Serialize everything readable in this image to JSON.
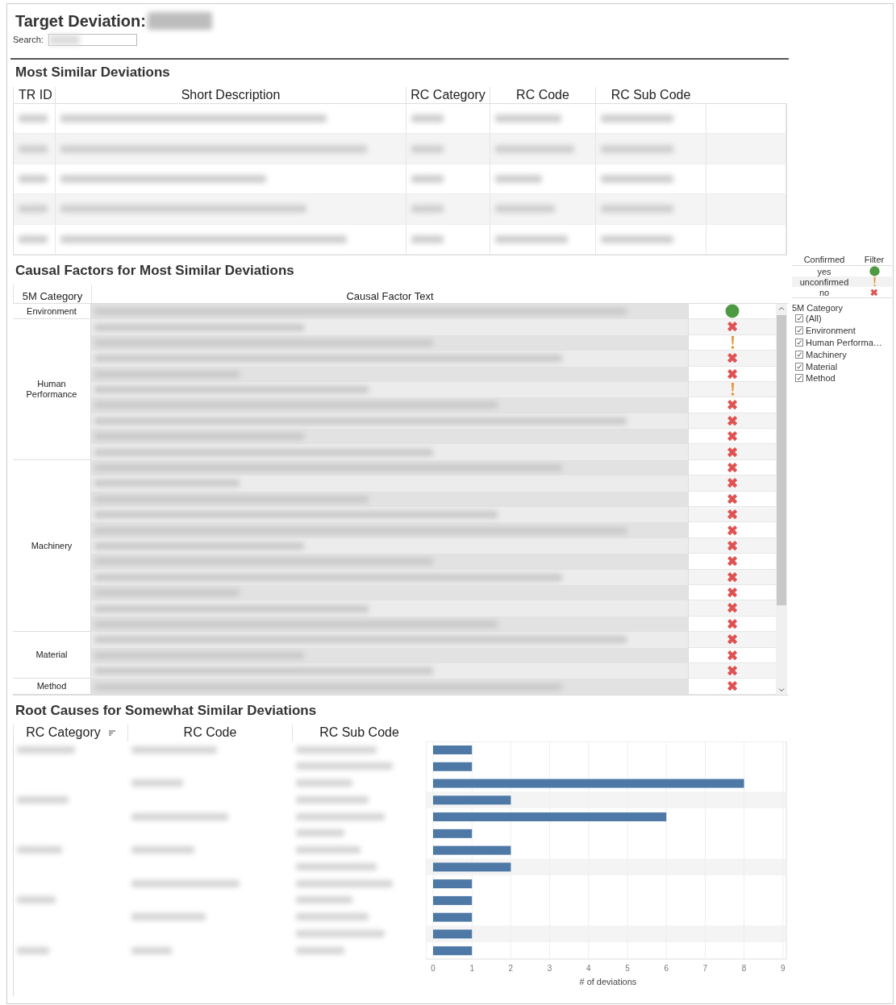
{
  "header": {
    "title": "Target Deviation:",
    "search_label": "Search:"
  },
  "similar": {
    "title": "Most Similar Deviations",
    "columns": [
      "TR ID",
      "Short Description",
      "RC Category",
      "RC Code",
      "RC Sub Code"
    ],
    "rows": [
      {
        "kind": "redacted"
      },
      {
        "kind": "redacted"
      },
      {
        "kind": "redacted"
      },
      {
        "kind": "redacted"
      },
      {
        "kind": "redacted"
      }
    ]
  },
  "causal": {
    "title": "Causal Factors for Most Similar Deviations",
    "columns": [
      "5M Category",
      "Causal Factor Text"
    ],
    "groups": [
      {
        "name": "Environment",
        "rows": [
          {
            "kind": "confirmed"
          }
        ]
      },
      {
        "name": "Human\nPerformance",
        "rows": [
          {
            "kind": "rejected"
          },
          {
            "kind": "unconfirmed"
          },
          {
            "kind": "rejected"
          },
          {
            "kind": "rejected"
          },
          {
            "kind": "unconfirmed"
          },
          {
            "kind": "rejected"
          },
          {
            "kind": "rejected"
          },
          {
            "kind": "rejected"
          },
          {
            "kind": "rejected"
          }
        ]
      },
      {
        "name": "Machinery",
        "rows": [
          {
            "kind": "rejected"
          },
          {
            "kind": "rejected"
          },
          {
            "kind": "rejected"
          },
          {
            "kind": "rejected"
          },
          {
            "kind": "rejected"
          },
          {
            "kind": "rejected"
          },
          {
            "kind": "rejected"
          },
          {
            "kind": "rejected"
          },
          {
            "kind": "rejected"
          },
          {
            "kind": "rejected"
          },
          {
            "kind": "rejected"
          }
        ]
      },
      {
        "name": "Material",
        "rows": [
          {
            "kind": "rejected"
          },
          {
            "kind": "rejected"
          },
          {
            "kind": "rejected"
          }
        ]
      },
      {
        "name": "Method",
        "rows": [
          {
            "kind": "rejected"
          }
        ]
      }
    ]
  },
  "legend": {
    "columns": [
      "Confirmed",
      "Filter"
    ],
    "items": [
      {
        "label": "yes",
        "kind": "confirmed"
      },
      {
        "label": "unconfirmed",
        "kind": "unconfirmed"
      },
      {
        "label": "no",
        "kind": "rejected"
      }
    ],
    "filter_title": "5M Category",
    "filters": [
      {
        "label": "(All)",
        "checked": true
      },
      {
        "label": "Environment",
        "checked": true
      },
      {
        "label": "Human Performa…",
        "checked": true
      },
      {
        "label": "Machinery",
        "checked": true
      },
      {
        "label": "Material",
        "checked": true
      },
      {
        "label": "Method",
        "checked": true
      }
    ]
  },
  "root_causes": {
    "title": "Root Causes for Somewhat Similar Deviations",
    "columns": [
      {
        "label": "RC Category",
        "sorted": true
      },
      {
        "label": "RC Code",
        "sorted": false
      },
      {
        "label": "RC Sub Code",
        "sorted": false
      }
    ],
    "chart_data": {
      "type": "bar",
      "orientation": "horizontal",
      "xlabel": "# of deviations",
      "values": [
        1,
        1,
        8,
        2,
        6,
        1,
        2,
        2,
        1,
        1,
        1,
        1,
        1
      ],
      "xlim": [
        0,
        9
      ],
      "xticks": [
        0,
        1,
        2,
        3,
        4,
        5,
        6,
        7,
        8,
        9
      ],
      "grid": true
    }
  }
}
